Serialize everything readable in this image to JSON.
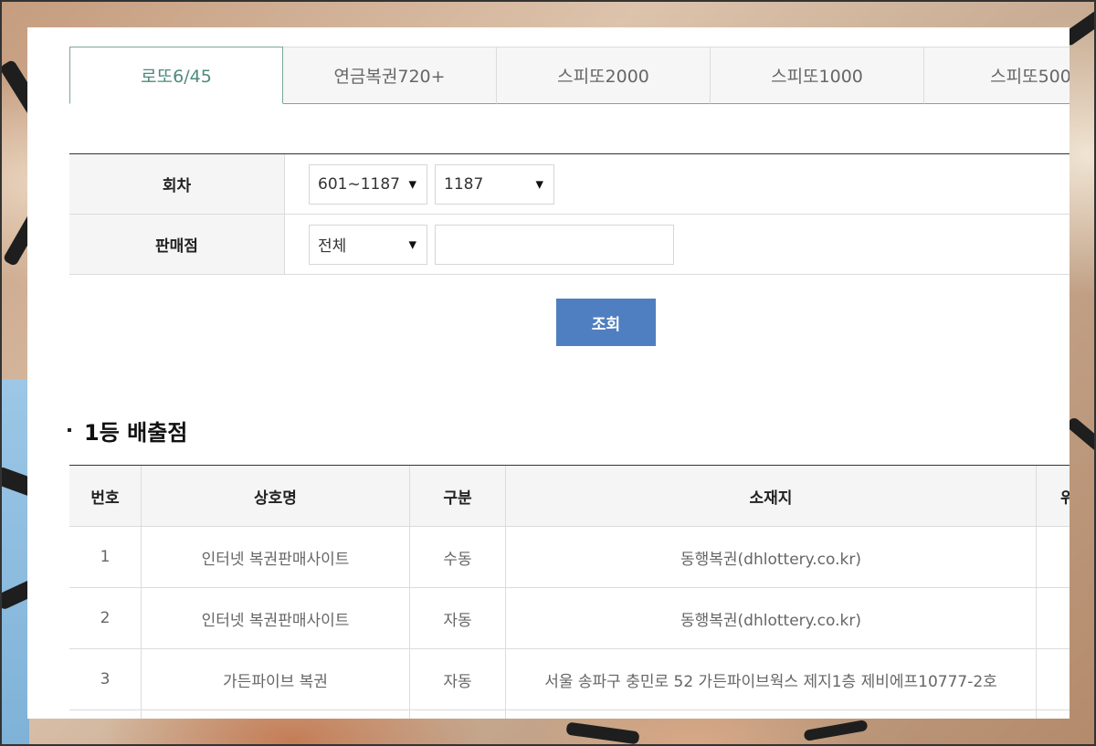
{
  "tabs": [
    {
      "label": "로또6/45",
      "active": true
    },
    {
      "label": "연금복권720+",
      "active": false
    },
    {
      "label": "스피또2000",
      "active": false
    },
    {
      "label": "스피또1000",
      "active": false
    },
    {
      "label": "스피또500",
      "active": false
    }
  ],
  "search": {
    "round_label": "회차",
    "round_range": "601~1187",
    "round_value": "1187",
    "store_label": "판매점",
    "store_filter": "전체",
    "store_input_value": "",
    "submit_label": "조회"
  },
  "section": {
    "title": "1등 배출점"
  },
  "table": {
    "headers": [
      "번호",
      "상호명",
      "구분",
      "소재지",
      "위"
    ],
    "rows": [
      [
        "1",
        "인터넷 복권판매사이트",
        "수동",
        "동행복권(dhlottery.co.kr)"
      ],
      [
        "2",
        "인터넷 복권판매사이트",
        "자동",
        "동행복권(dhlottery.co.kr)"
      ],
      [
        "3",
        "가든파이브 복권",
        "자동",
        "서울 송파구 충민로 52 가든파이브웍스 제지1층 제비에프10777-2호"
      ],
      [
        "",
        "",
        "",
        ""
      ]
    ]
  },
  "colors": {
    "accent_tab": "#4e8a7d",
    "button": "#4f7fc0"
  }
}
